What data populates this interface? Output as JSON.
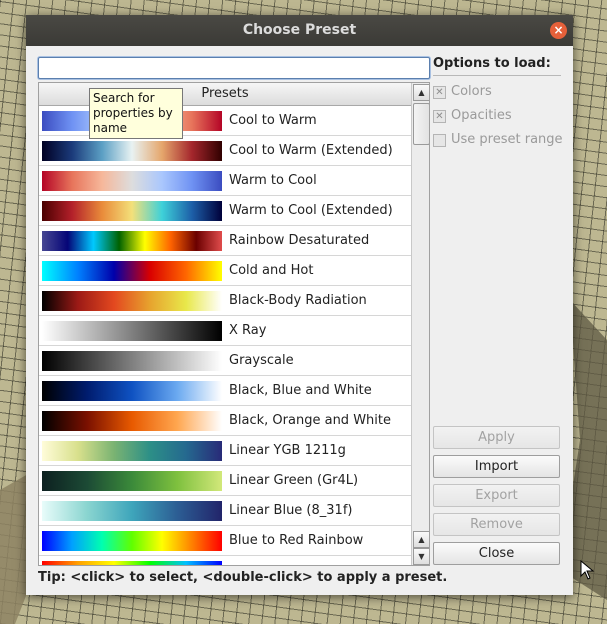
{
  "dialog": {
    "title": "Choose Preset",
    "close_glyph": "×"
  },
  "search": {
    "value": "",
    "placeholder": ""
  },
  "tooltip": {
    "text": "Search for properties by name"
  },
  "presets": {
    "header": "Presets",
    "items": [
      {
        "label": "Cool to Warm",
        "gradient": "linear-gradient(90deg,#3b4cc0,#6f92f3,#aac7fd,#dddddd,#f6b79a,#e7745b,#b40426)"
      },
      {
        "label": "Cool to Warm (Extended)",
        "gradient": "linear-gradient(90deg,#000022,#1b3a7a,#5b9fc4,#e8f2f2,#e5a66c,#a4262c,#300000)"
      },
      {
        "label": "Warm to Cool",
        "gradient": "linear-gradient(90deg,#b40426,#e7745b,#f6b79a,#dddddd,#aac7fd,#6f92f3,#3b4cc0)"
      },
      {
        "label": "Warm to Cool (Extended)",
        "gradient": "linear-gradient(90deg,#4a0000,#b3202a,#e98b3a,#f3e07a,#3ed1d9,#1d5fa8,#00003a)"
      },
      {
        "label": "Rainbow Desaturated",
        "gradient": "linear-gradient(90deg,#474793,#050577,#00c9ff,#006100,#ffff00,#ff6300,#6b0000,#e04c4c)"
      },
      {
        "label": "Cold and Hot",
        "gradient": "linear-gradient(90deg,#00ffff,#0080ff,#0000aa,#d90000,#ff6600,#ffff00)"
      },
      {
        "label": "Black-Body Radiation",
        "gradient": "linear-gradient(90deg,#000000,#9c1a16,#e3481f,#e7a32e,#e8e84a,#ffffff)"
      },
      {
        "label": "X Ray",
        "gradient": "linear-gradient(90deg,#ffffff,#000000)"
      },
      {
        "label": "Grayscale",
        "gradient": "linear-gradient(90deg,#000000,#ffffff)"
      },
      {
        "label": "Black, Blue and White",
        "gradient": "linear-gradient(90deg,#000000,#001c6e,#0f52c2,#6aa9f0,#ffffff)"
      },
      {
        "label": "Black, Orange and White",
        "gradient": "linear-gradient(90deg,#000000,#7a1000,#e85a00,#ffa64f,#ffffff)"
      },
      {
        "label": "Linear YGB 1211g",
        "gradient": "linear-gradient(90deg,#fffcd9,#d8e08c,#7ab372,#2c8f87,#25698f,#282a78)"
      },
      {
        "label": "Linear Green (Gr4L)",
        "gradient": "linear-gradient(90deg,#0d2020,#1c4a35,#3b8a3a,#7ec03e,#d2e87a)"
      },
      {
        "label": "Linear Blue (8_31f)",
        "gradient": "linear-gradient(90deg,#e8fcfa,#8ad5d0,#3ea5bb,#2c5e94,#22246a)"
      },
      {
        "label": "Blue to Red Rainbow",
        "gradient": "linear-gradient(90deg,#0000ff,#00a0ff,#00ffb0,#60ff00,#ffff00,#ff8000,#ff0000)"
      },
      {
        "label": "",
        "gradient": "linear-gradient(90deg,#ff0000,#ffa000,#ffff00,#00ff00,#00c0ff,#0000ff)"
      }
    ]
  },
  "options": {
    "title": "Options to load:",
    "colors": {
      "label": "Colors",
      "checked": true
    },
    "opacities": {
      "label": "Opacities",
      "checked": true
    },
    "preset_range": {
      "label": "Use preset range",
      "checked": false
    },
    "check_glyph": "✕"
  },
  "buttons": {
    "apply": "Apply",
    "import": "Import",
    "export": "Export",
    "remove": "Remove",
    "close": "Close"
  },
  "scrollbar": {
    "up_glyph": "▲",
    "down_glyph": "▼"
  },
  "tip": "Tip: <click> to select, <double-click> to apply a preset.",
  "colors": {
    "titlebar": "#3b3a36",
    "window": "#efefef",
    "close_accent": "#e5603a",
    "tooltip_bg": "#ffffdc"
  }
}
